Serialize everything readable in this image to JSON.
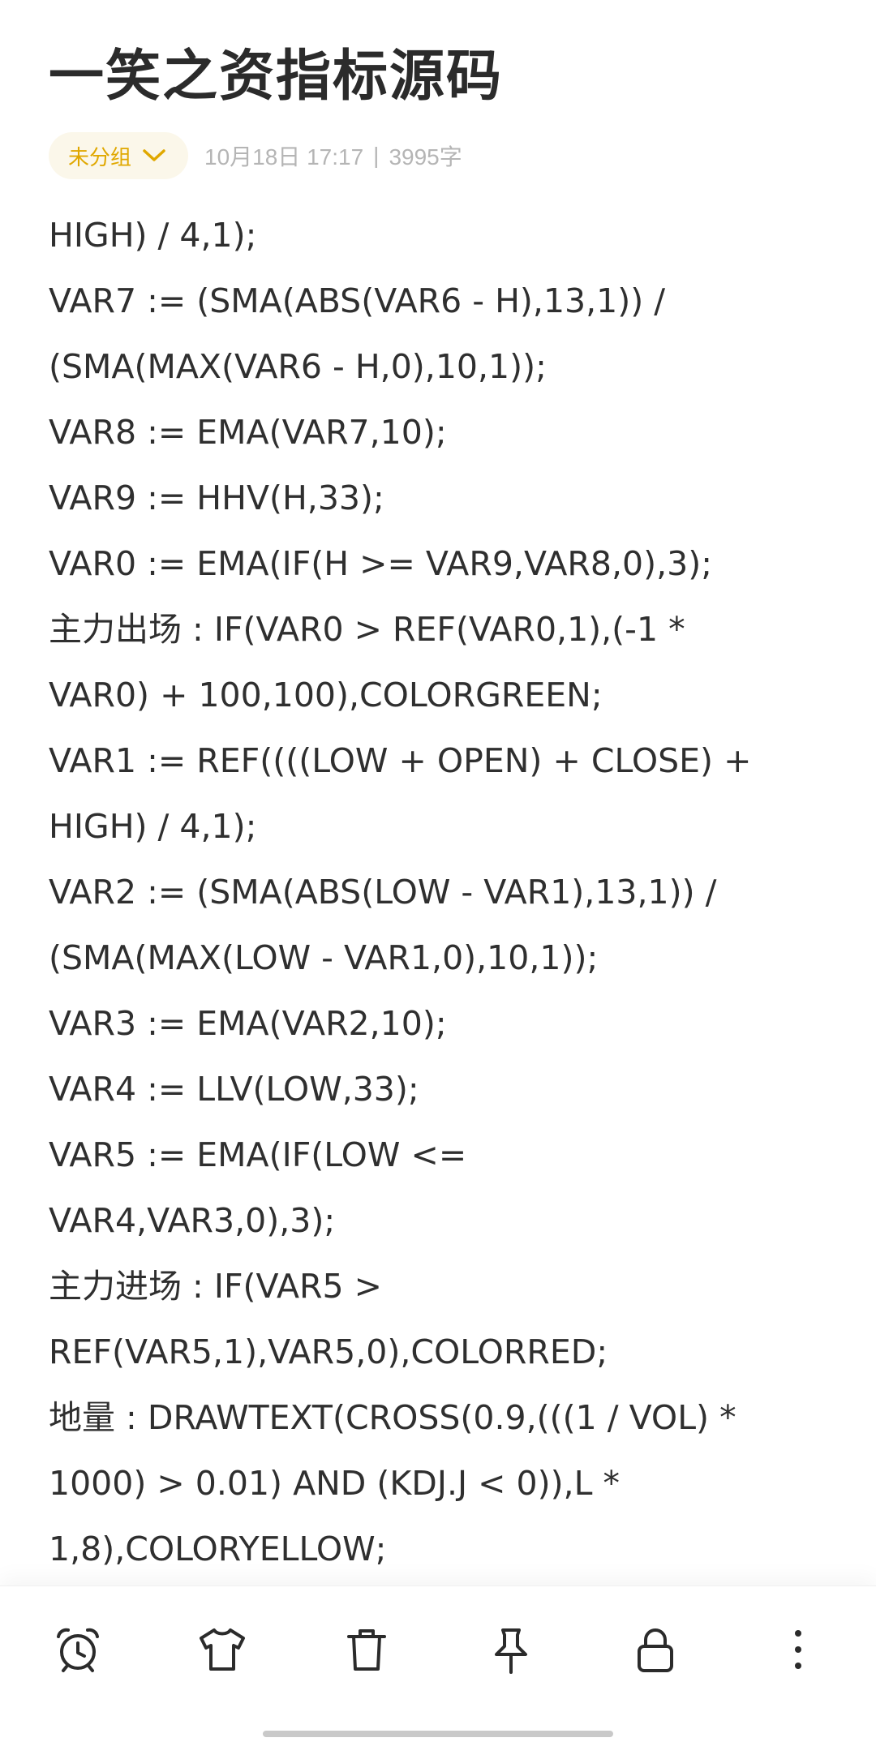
{
  "note": {
    "title": "一笑之资指标源码",
    "group_label": "未分组",
    "date_time": "10月18日 17:17",
    "separator": "|",
    "char_count": "3995字"
  },
  "content": {
    "lines": [
      "HIGH) / 4,1);",
      "VAR7 := (SMA(ABS(VAR6 - H),13,1)) /",
      "(SMA(MAX(VAR6 - H,0),10,1));",
      "VAR8 := EMA(VAR7,10);",
      "VAR9 := HHV(H,33);",
      "VAR0 := EMA(IF(H >= VAR9,VAR8,0),3);",
      "主力出场 : IF(VAR0 > REF(VAR0,1),(-1 *",
      "VAR0) + 100,100),COLORGREEN;",
      "VAR1 := REF((((LOW + OPEN) + CLOSE) +",
      "HIGH) / 4,1);",
      "VAR2 := (SMA(ABS(LOW - VAR1),13,1)) /",
      "(SMA(MAX(LOW - VAR1,0),10,1));",
      "VAR3 := EMA(VAR2,10);",
      "VAR4 := LLV(LOW,33);",
      "VAR5 := EMA(IF(LOW <=",
      "VAR4,VAR3,0),3);",
      "主力进场 : IF(VAR5 >",
      "REF(VAR5,1),VAR5,0),COLORRED;",
      "地量 : DRAWTEXT(CROSS(0.9,(((1 / VOL) *",
      "1000) > 0.01) AND (KDJ.J < 0)),L *",
      "1,8),COLORYELLOW;"
    ]
  },
  "toolbar": {
    "icons": [
      "alarm-clock-icon",
      "shirt-icon",
      "trash-icon",
      "pin-icon",
      "lock-icon",
      "more-vertical-icon"
    ]
  },
  "colors": {
    "accent": "#e0a800",
    "pill_background": "#fbf7ea",
    "meta_text": "#b5b5b5",
    "body_text": "#2f2f2f"
  }
}
